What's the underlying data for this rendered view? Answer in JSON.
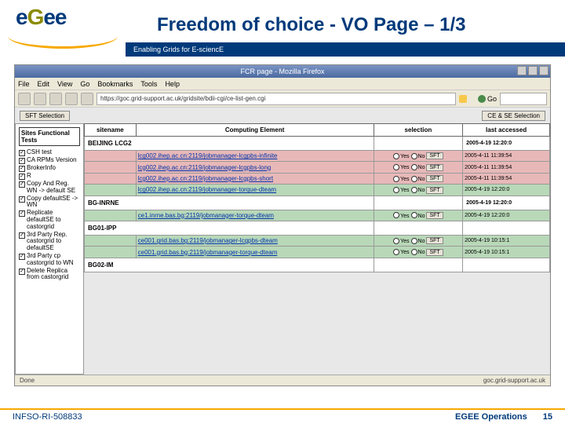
{
  "slide": {
    "title": "Freedom of choice - VO Page – 1/3",
    "tagline": "Enabling Grids for E-sciencE",
    "footer_left": "INFSO-RI-508833",
    "footer_right": "EGEE Operations",
    "page_num": "15"
  },
  "browser": {
    "title": "FCR page - Mozilla Firefox",
    "menu": [
      "File",
      "Edit",
      "View",
      "Go",
      "Bookmarks",
      "Tools",
      "Help"
    ],
    "url": "https://goc.grid-support.ac.uk/gridsite/bdii-cgi/ce-list-gen.cgi",
    "go_label": "Go",
    "status_left": "Done",
    "status_right": "goc.grid-support.ac.uk"
  },
  "page": {
    "sft_selection_btn": "SFT Selection",
    "ce_se_selection_btn": "CE & SE Selection",
    "sidebar_title": "Sites Functional Tests",
    "tests": [
      {
        "label": "CSH test",
        "checked": true
      },
      {
        "label": "CA RPMs Version",
        "checked": true
      },
      {
        "label": "BrokerInfo",
        "checked": true
      },
      {
        "label": "R",
        "checked": true
      },
      {
        "label": "Copy And Reg. WN ->  default SE",
        "checked": true
      },
      {
        "label": "Copy defaultSE -> WN",
        "checked": true
      },
      {
        "label": "Replicate defaultSE to castorgrid",
        "checked": true
      },
      {
        "label": "3rd Party Rep. castorgrid to defaultSE",
        "checked": true
      },
      {
        "label": "3rd Party cp castorgrid to WN",
        "checked": true
      },
      {
        "label": "Delete Replica from castorgrid",
        "checked": true
      }
    ],
    "columns": [
      "sitename",
      "Computing Element",
      "selection",
      "last accessed"
    ],
    "sel_labels": {
      "yes": "Yes",
      "no": "No",
      "sft": "SFT"
    },
    "rows": [
      {
        "type": "site",
        "site": "BEIJING LCG2",
        "date": "2005-4-19 12:20:0"
      },
      {
        "type": "ce",
        "cls": "red",
        "ce": "lcg002.ihep.ac.cn:2119/jobmanager-lcgpbs-infinite",
        "date": "2005-4-11 11:39:54"
      },
      {
        "type": "ce",
        "cls": "red",
        "ce": "lcg002.ihep.ac.cn:2119/jobmanager-lcgpbs-long",
        "date": "2005-4-11 11:39:54"
      },
      {
        "type": "ce",
        "cls": "red",
        "ce": "lcg002.ihep.ac.cn:2119/jobmanager-lcgpbs-short",
        "date": "2005-4-11 11:39:54"
      },
      {
        "type": "ce",
        "cls": "green",
        "ce": "lcg002.ihep.ac.cn:2119/jobmanager-torque-dteam",
        "date": "2005-4-19 12:20:0"
      },
      {
        "type": "site",
        "site": "BG-INRNE",
        "date": "2005-4-19 12:20:0"
      },
      {
        "type": "ce",
        "cls": "green",
        "ce": "ce1.inrne.bas.bg:2119/jobmanager-torque-dteam",
        "date": "2005-4-19 12:20:0"
      },
      {
        "type": "site",
        "site": "BG01-IPP",
        "date": ""
      },
      {
        "type": "ce",
        "cls": "green",
        "ce": "ce001.grid.bas.bg:2119/jobmanager-lcgpbs-dteam",
        "date": "2005-4-19 10:15:1"
      },
      {
        "type": "ce",
        "cls": "green",
        "ce": "ce001.grid.bas.bg:2119/jobmanager-torque-dteam",
        "date": "2005-4-19 10:15:1"
      },
      {
        "type": "site",
        "site": "BG02-IM",
        "date": ""
      }
    ]
  }
}
